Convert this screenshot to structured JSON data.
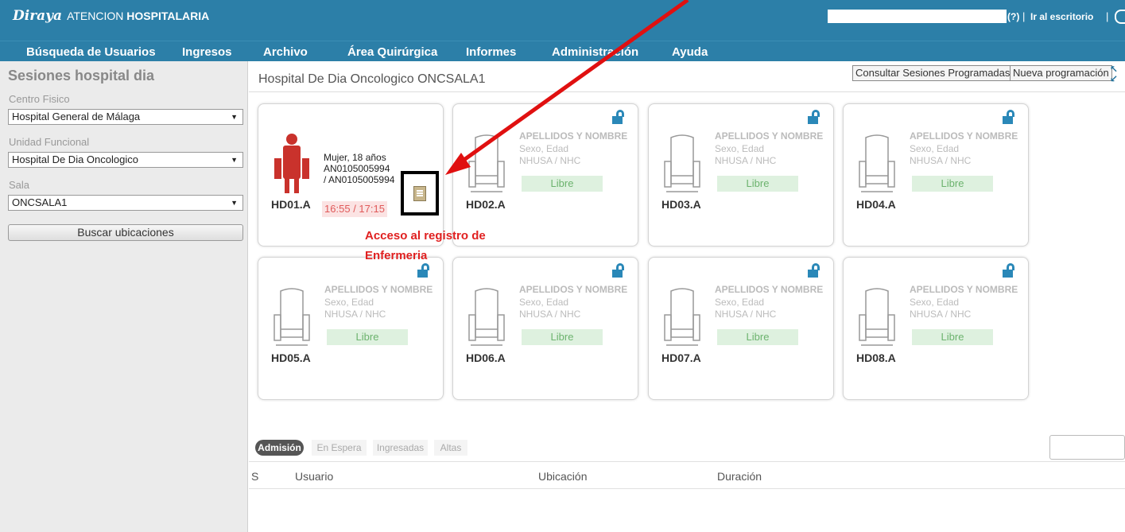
{
  "brand": {
    "logo": "Diraya",
    "app_name_light": "ATENCION",
    "app_name_bold": "HOSPITALARIA"
  },
  "topbar": {
    "help_label": "(?)",
    "desk_link": "Ir al escritorio",
    "separator": "|"
  },
  "nav": {
    "items": [
      "Búsqueda de Usuarios",
      "Ingresos",
      "Archivo",
      "Área Quirúrgica",
      "Informes",
      "Administración",
      "Ayuda"
    ]
  },
  "sidebar": {
    "title": "Sesiones hospital dia",
    "centro_label": "Centro Fisico",
    "centro_value": "Hospital General de Málaga",
    "unidad_label": "Unidad Funcional",
    "unidad_value": "Hospital De Dia Oncologico",
    "sala_label": "Sala",
    "sala_value": "ONCSALA1",
    "search_button": "Buscar ubicaciones"
  },
  "main": {
    "breadcrumb": "Hospital De Dia Oncologico ONCSALA1",
    "btn_consultar": "Consultar Sesiones Programadas",
    "btn_nueva": "Nueva programación"
  },
  "beds": [
    {
      "code": "HD01.A",
      "occupied": true,
      "sex_age": "Mujer, 18 años",
      "nhusa": "AN0105005994 / AN0105005994",
      "time": "16:55 / 17:15"
    },
    {
      "code": "HD02.A",
      "occupied": false,
      "name": "APELLIDOS Y NOMBRE",
      "sex_age": "Sexo, Edad",
      "nhusa": "NHUSA / NHC",
      "status": "Libre"
    },
    {
      "code": "HD03.A",
      "occupied": false,
      "name": "APELLIDOS Y NOMBRE",
      "sex_age": "Sexo, Edad",
      "nhusa": "NHUSA / NHC",
      "status": "Libre"
    },
    {
      "code": "HD04.A",
      "occupied": false,
      "name": "APELLIDOS Y NOMBRE",
      "sex_age": "Sexo, Edad",
      "nhusa": "NHUSA / NHC",
      "status": "Libre"
    },
    {
      "code": "HD05.A",
      "occupied": false,
      "name": "APELLIDOS Y NOMBRE",
      "sex_age": "Sexo, Edad",
      "nhusa": "NHUSA / NHC",
      "status": "Libre"
    },
    {
      "code": "HD06.A",
      "occupied": false,
      "name": "APELLIDOS Y NOMBRE",
      "sex_age": "Sexo, Edad",
      "nhusa": "NHUSA / NHC",
      "status": "Libre"
    },
    {
      "code": "HD07.A",
      "occupied": false,
      "name": "APELLIDOS Y NOMBRE",
      "sex_age": "Sexo, Edad",
      "nhusa": "NHUSA / NHC",
      "status": "Libre"
    },
    {
      "code": "HD08.A",
      "occupied": false,
      "name": "APELLIDOS Y NOMBRE",
      "sex_age": "Sexo, Edad",
      "nhusa": "NHUSA / NHC",
      "status": "Libre"
    }
  ],
  "annotation": {
    "line1": "Acceso al registro de",
    "line2": "Enfermeria",
    "color": "#e02020"
  },
  "tabs": {
    "admision": "Admisión",
    "espera": "En Espera",
    "ingresadas": "Ingresadas",
    "altas": "Altas"
  },
  "table": {
    "columns": [
      "S",
      "Usuario",
      "Ubicación",
      "Duración"
    ]
  },
  "colors": {
    "header_bg": "#2c7fa8",
    "occupied_chair": "#c9322c",
    "free_badge_bg": "#def1df",
    "time_badge_bg": "#fbe3e3",
    "lock": "#2a88b8"
  }
}
